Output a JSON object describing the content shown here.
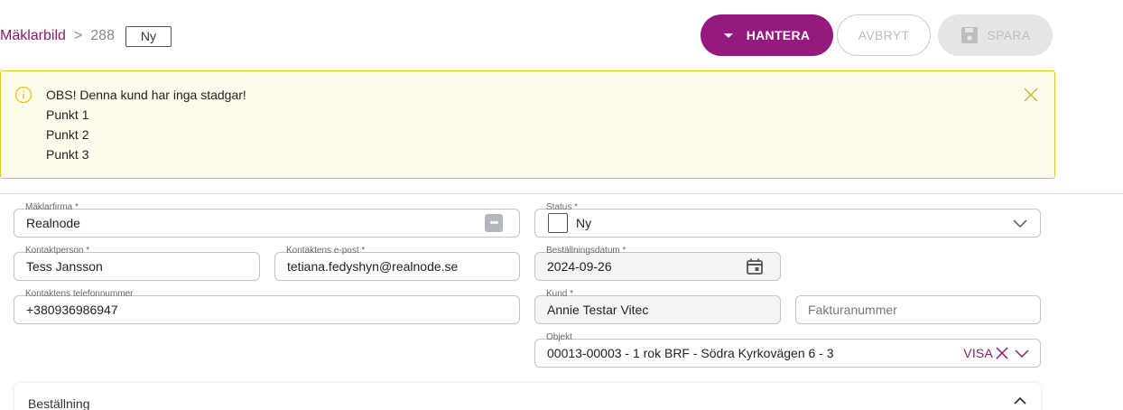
{
  "breadcrumb": {
    "root": "Mäklarbild",
    "separator": ">",
    "id": "288",
    "badge": "Ny"
  },
  "toolbar": {
    "manage_label": "HANTERA",
    "cancel_label": "AVBRYT",
    "save_label": "SPARA"
  },
  "alert": {
    "lines": [
      "OBS! Denna kund har inga stadgar!",
      "Punkt 1",
      "Punkt 2",
      "Punkt 3"
    ],
    "icon": "info-icon",
    "color": "#e0c42a"
  },
  "form": {
    "broker_firm": {
      "label": "Mäklarfirma *",
      "value": "Realnode"
    },
    "status": {
      "label": "Status *",
      "value": "Ny"
    },
    "contact_person": {
      "label": "Kontaktperson *",
      "value": "Tess Jansson"
    },
    "contact_email": {
      "label": "Kontaktens e-post *",
      "value": "tetiana.fedyshyn@realnode.se"
    },
    "order_date": {
      "label": "Beställningsdatum *",
      "value": "2024-09-26"
    },
    "contact_phone": {
      "label": "Kontaktens telefonnummer",
      "value": "+380936986947"
    },
    "customer": {
      "label": "Kund *",
      "value": "Annie Testar Vitec"
    },
    "invoice_number": {
      "placeholder": "Fakturanummer"
    },
    "object": {
      "label": "Objekt",
      "value": "00013-00003 - 1 rok BRF - Södra Kyrkovägen 6 - 3",
      "action": "VISA"
    }
  },
  "section": {
    "title": "Beställning"
  },
  "colors": {
    "brand": "#951a7f",
    "link": "#8c1a6a",
    "alert_bg": "#fffbec"
  }
}
